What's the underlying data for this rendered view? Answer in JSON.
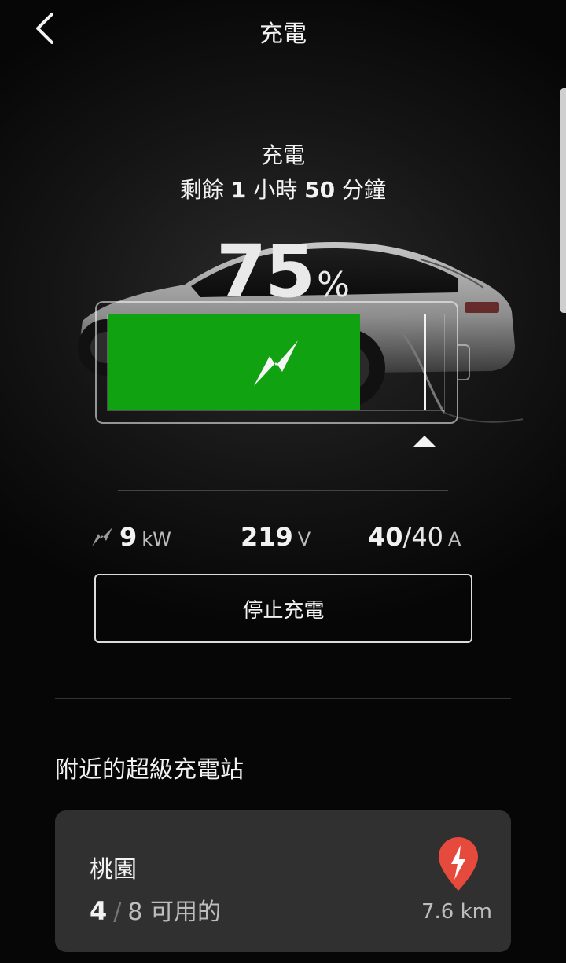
{
  "header": {
    "title": "充電"
  },
  "charging": {
    "state": "充電",
    "remaining_prefix": "剩餘",
    "hours": "1",
    "hours_unit": "小時",
    "minutes": "50",
    "minutes_unit": "分鐘",
    "percent_value": "75",
    "percent_sign": "%",
    "battery_level_fraction": 0.75,
    "charge_limit_fraction": 0.94,
    "fill_color": "#10a210"
  },
  "stats": {
    "power_icon": "bolt-icon",
    "power_value": "9",
    "power_unit": "kW",
    "voltage_value": "219",
    "voltage_unit": "V",
    "current_value": "40",
    "current_max": "/40",
    "current_unit": "A"
  },
  "stop_button": {
    "label": "停止充電"
  },
  "nearby": {
    "title": "附近的超級充電站",
    "stations": [
      {
        "name": "桃園",
        "available": "4",
        "separator": "/",
        "total": "8",
        "available_label": "可用的",
        "distance": "7.6 km",
        "pin_color": "#e64a3c"
      }
    ]
  }
}
